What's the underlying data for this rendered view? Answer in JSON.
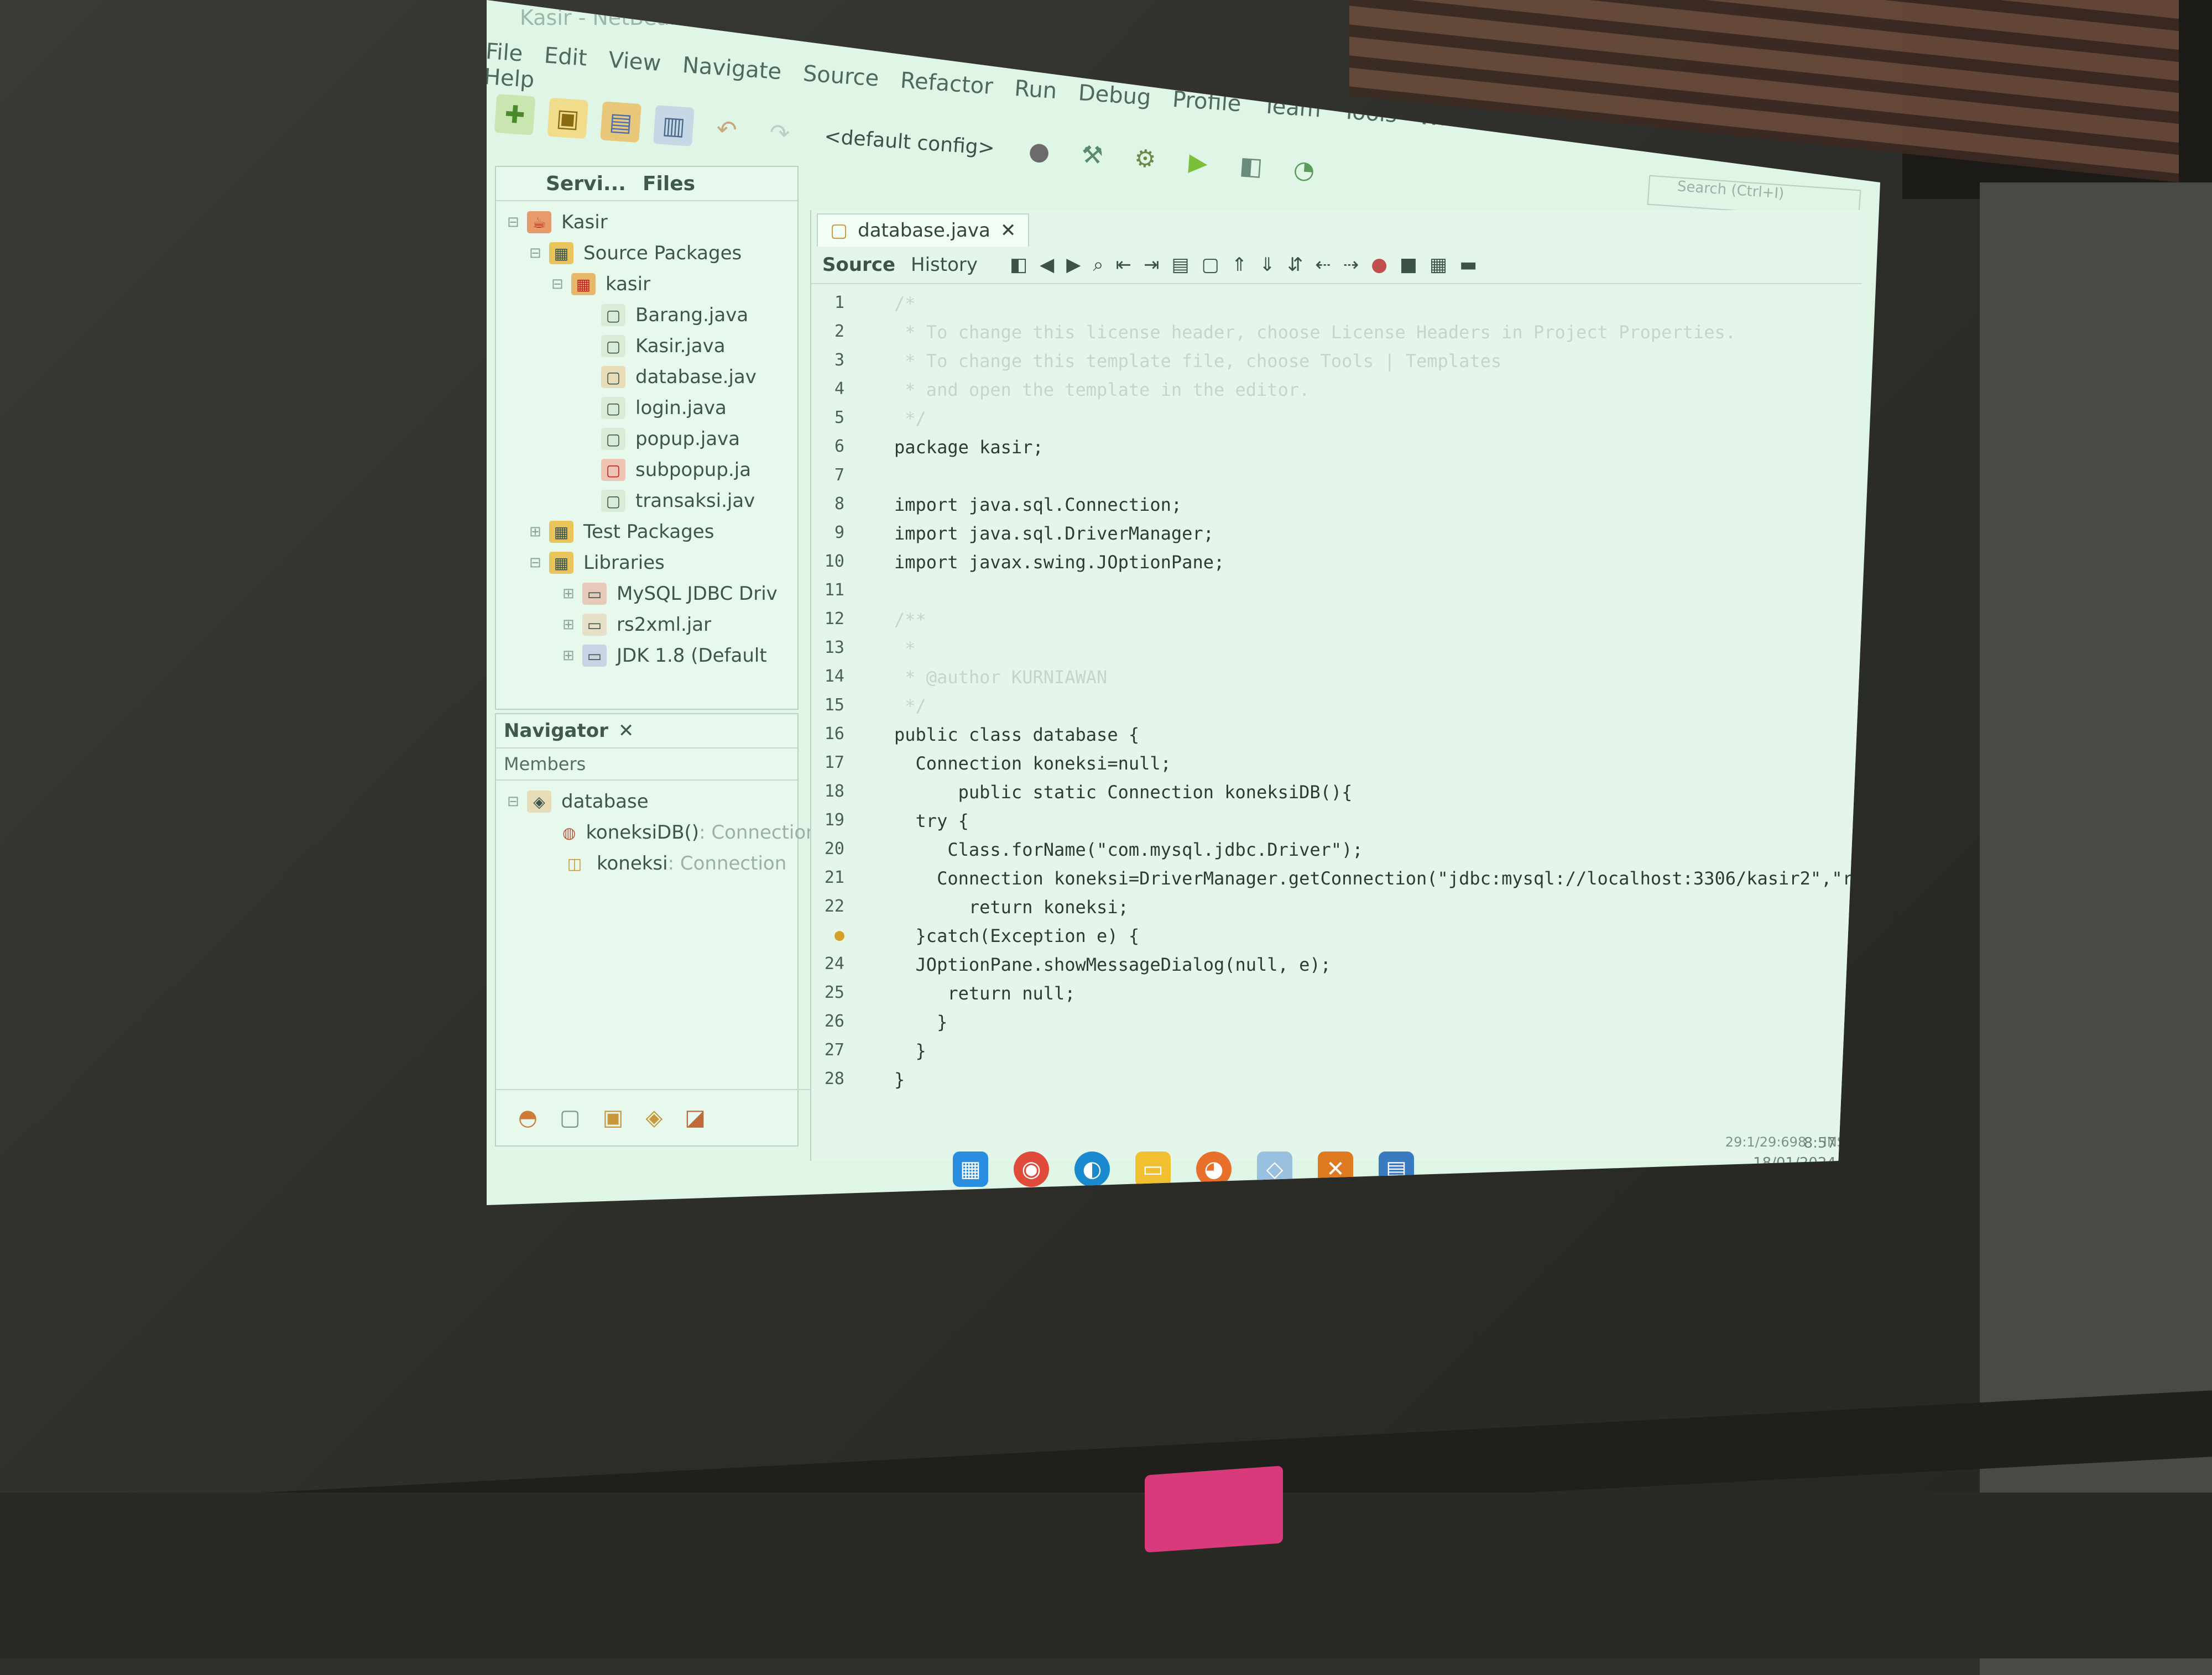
{
  "window": {
    "title": "Kasir - NetBeans IDE 8.2"
  },
  "menu": [
    "File",
    "Edit",
    "View",
    "Navigate",
    "Source",
    "Refactor",
    "Run",
    "Debug",
    "Profile",
    "Team",
    "Tools",
    "Window",
    "Help"
  ],
  "toolbar": {
    "config": "<default config>",
    "search_placeholder": "Search (Ctrl+I)"
  },
  "projects": {
    "tabs": [
      "Servi...",
      "Files"
    ],
    "tree": [
      {
        "label": "Kasir",
        "level": 0
      },
      {
        "label": "Source Packages",
        "level": 1
      },
      {
        "label": "kasir",
        "level": 2
      },
      {
        "label": "Barang.java",
        "level": 3
      },
      {
        "label": "Kasir.java",
        "level": 3
      },
      {
        "label": "database.jav",
        "level": 3
      },
      {
        "label": "login.java",
        "level": 3
      },
      {
        "label": "popup.java",
        "level": 3
      },
      {
        "label": "subpopup.ja",
        "level": 3
      },
      {
        "label": "transaksi.jav",
        "level": 3
      },
      {
        "label": "Test Packages",
        "level": 1
      },
      {
        "label": "Libraries",
        "level": 1
      },
      {
        "label": "MySQL JDBC Driv",
        "level": 2
      },
      {
        "label": "rs2xml.jar",
        "level": 2
      },
      {
        "label": "JDK 1.8 (Default",
        "level": 2
      }
    ]
  },
  "navigator": {
    "title": "Navigator",
    "filter": "Members",
    "root": "database",
    "members": [
      {
        "name": "koneksiDB()",
        "type": " : Connection"
      },
      {
        "name": "koneksi",
        "type": " : Connection"
      }
    ]
  },
  "editor": {
    "tab": "database.java",
    "subtabs": [
      "Source",
      "History"
    ],
    "lines": [
      "/*",
      " * To change this license header, choose License Headers in Project Properties.",
      " * To change this template file, choose Tools | Templates",
      " * and open the template in the editor.",
      " */",
      "package kasir;",
      "",
      "import java.sql.Connection;",
      "import java.sql.DriverManager;",
      "import javax.swing.JOptionPane;",
      "",
      "/**",
      " *",
      " * @author KURNIAWAN",
      " */",
      "public class database {",
      "  Connection koneksi=null;",
      "      public static Connection koneksiDB(){",
      "  try {",
      "     Class.forName(\"com.mysql.jdbc.Driver\");",
      "    Connection koneksi=DriverManager.getConnection(\"jdbc:mysql://localhost:3306/kasir2\",\"root",
      "       return koneksi;",
      "  }catch(Exception e) {",
      "  JOptionPane.showMessageDialog(null, e);",
      "     return null;",
      "    }",
      "  }",
      "}"
    ],
    "status": "29:1/29:698",
    "mode": "INS"
  },
  "taskbar": {
    "time": "8:57",
    "date": "18/01/2024"
  }
}
